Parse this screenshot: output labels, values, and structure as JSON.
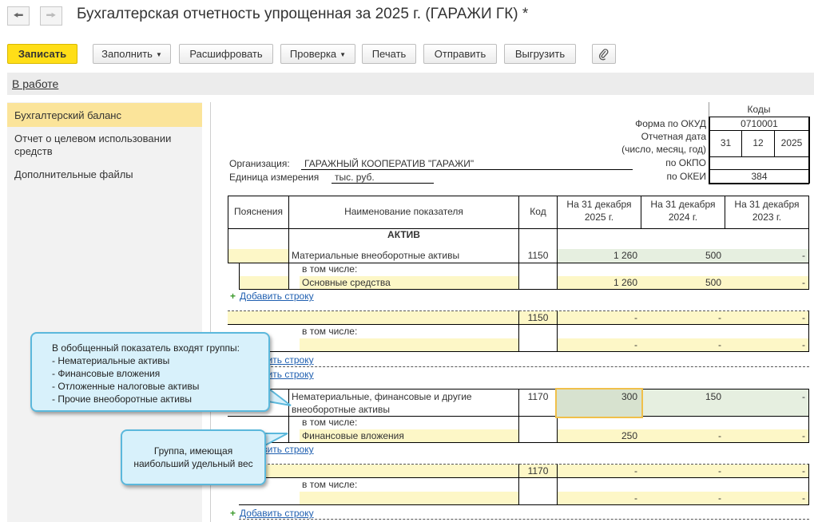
{
  "header": {
    "back_icon": "arrow-left-icon",
    "forward_icon": "arrow-right-icon",
    "title": "Бухгалтерская отчетность упрощенная за 2025 г. (ГАРАЖИ ГК) *"
  },
  "toolbar": {
    "save": "Записать",
    "fill": "Заполнить",
    "decode": "Расшифровать",
    "check": "Проверка",
    "print": "Печать",
    "send": "Отправить",
    "export": "Выгрузить",
    "attach_icon": "paperclip-icon",
    "primary_color": "#ffde17"
  },
  "status": {
    "label": "В работе"
  },
  "sidebar": {
    "items": [
      {
        "label": "Бухгалтерский баланс"
      },
      {
        "label": "Отчет о целевом использовании средств"
      },
      {
        "label": "Дополнительные файлы"
      }
    ]
  },
  "form": {
    "codes_header": "Коды",
    "okud_label": "Форма по ОКУД",
    "okud_value": "0710001",
    "date_label_1": "Отчетная дата",
    "date_label_2": "(число, месяц, год)",
    "date_day": "31",
    "date_month": "12",
    "date_year": "2025",
    "okpo_label": "по ОКПО",
    "okei_label": "по ОКЕИ",
    "okei_value": "384",
    "org_label": "Организация:",
    "org_value": "ГАРАЖНЫЙ КООПЕРАТИВ \"ГАРАЖИ\"",
    "unit_label": "Единица измерения",
    "unit_value": "тыс. руб."
  },
  "table": {
    "columns": [
      "Пояснения",
      "Наименование показателя",
      "Код",
      "На 31 декабря 2025 г.",
      "На 31 декабря 2024 г.",
      "На 31 декабря 2023 г."
    ],
    "col4_line1": "На 31 декабря",
    "col4_line2": "2025 г.",
    "col5_line1": "На 31 декабря",
    "col5_line2": "2024 г.",
    "col6_line1": "На 31 декабря",
    "col6_line2": "2023 г.",
    "section": "АКТИВ",
    "row1": {
      "name": "Материальные внеоборотные активы",
      "code": "1150",
      "v2025": "1 260",
      "v2024": "500",
      "v2023": "-"
    },
    "including": "в том числе:",
    "row1_sub": {
      "name": "Основные средства",
      "v2025": "1 260",
      "v2024": "500",
      "v2023": "-"
    },
    "add_row": "Добавить строку",
    "row2": {
      "code": "1150",
      "v2025": "-",
      "v2024": "-",
      "v2023": "-"
    },
    "row2_sub": {
      "v2025": "-",
      "v2024": "-",
      "v2023": "-"
    },
    "row3": {
      "name_line1": "Нематериальные, финансовые и другие",
      "name_line2": "внеоборотные активы",
      "code": "1170",
      "v2025": "300",
      "v2024": "150",
      "v2023": "-"
    },
    "row3_sub": {
      "name": "Финансовые вложения",
      "v2025": "250",
      "v2024": "-",
      "v2023": "-"
    },
    "row4": {
      "code": "1170",
      "v2025": "-",
      "v2024": "-",
      "v2023": "-"
    },
    "row4_sub": {
      "v2025": "-",
      "v2024": "-",
      "v2023": "-"
    }
  },
  "callout1": {
    "line1": "В обобщенный показатель входят группы:",
    "line2": "- Нематериальные активы",
    "line3": "- Финансовые вложения",
    "line4": "- Отложенные налоговые активы",
    "line5": "- Прочие внеоборотные активы"
  },
  "callout2": {
    "line1": "Группа, имеющая",
    "line2": "наибольший удельный вес"
  }
}
